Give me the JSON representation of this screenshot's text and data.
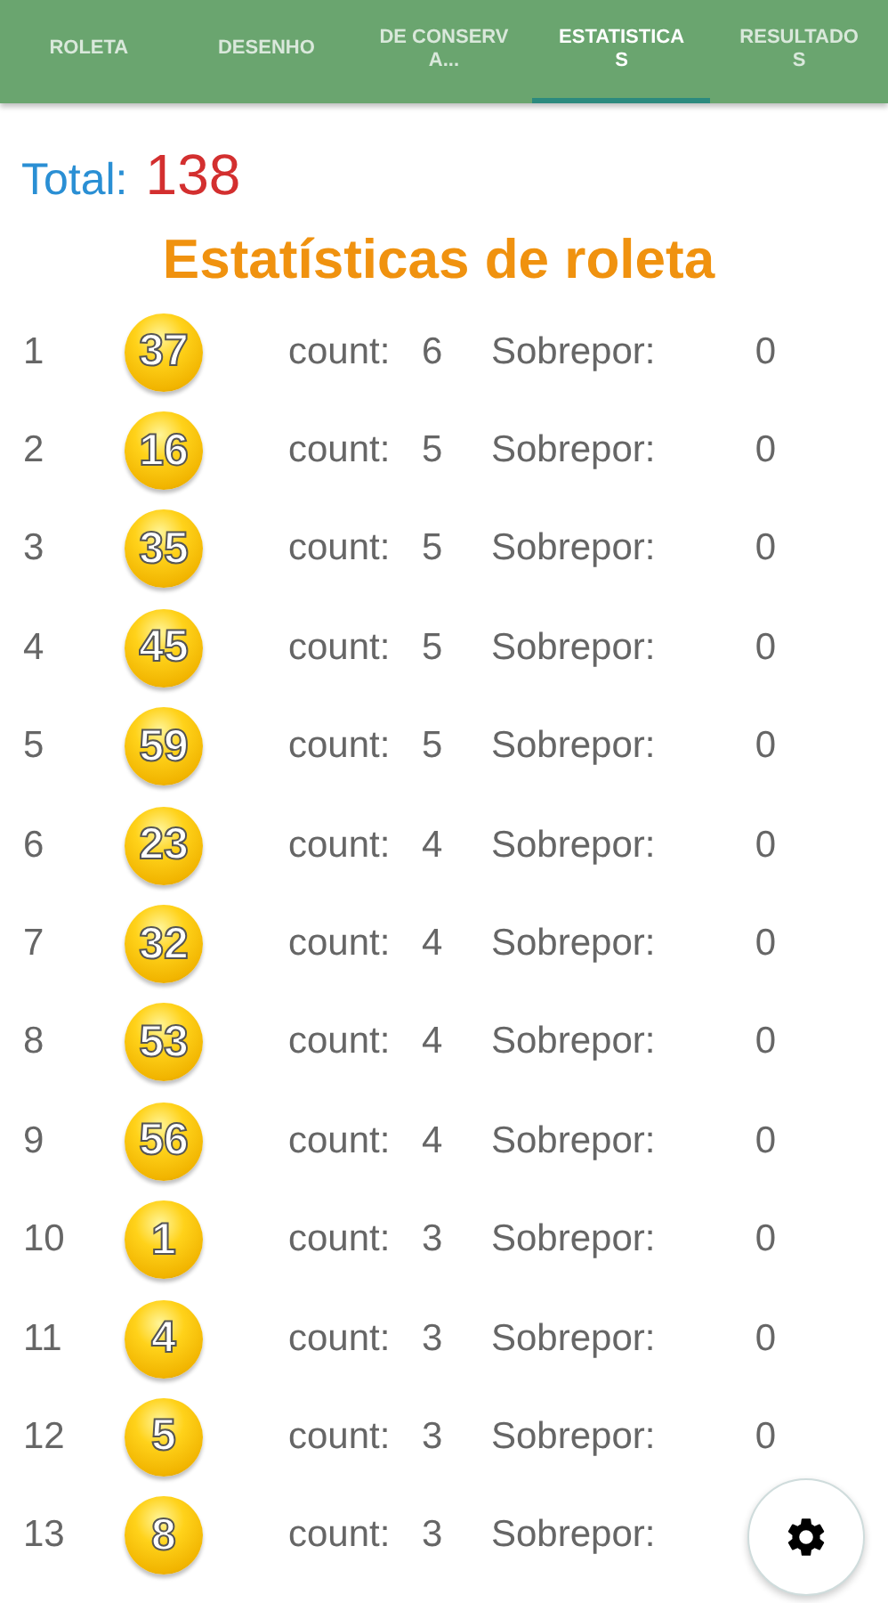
{
  "tabs": [
    {
      "label": "ROLETA",
      "selected": false
    },
    {
      "label": "DESENHO",
      "selected": false
    },
    {
      "label": "DE CONSERVA...",
      "selected": false
    },
    {
      "label": "ESTATISTICAS",
      "selected": true
    },
    {
      "label": "RESULTADOS",
      "selected": false
    }
  ],
  "total": {
    "label": "Total:",
    "value": "138"
  },
  "title": "Estatísticas de roleta",
  "rows": [
    {
      "rank": "1",
      "ball": "37",
      "count_label": "count:",
      "count": "6",
      "overlap_label": "Sobrepor:",
      "overlap": "0"
    },
    {
      "rank": "2",
      "ball": "16",
      "count_label": "count:",
      "count": "5",
      "overlap_label": "Sobrepor:",
      "overlap": "0"
    },
    {
      "rank": "3",
      "ball": "35",
      "count_label": "count:",
      "count": "5",
      "overlap_label": "Sobrepor:",
      "overlap": "0"
    },
    {
      "rank": "4",
      "ball": "45",
      "count_label": "count:",
      "count": "5",
      "overlap_label": "Sobrepor:",
      "overlap": "0"
    },
    {
      "rank": "5",
      "ball": "59",
      "count_label": "count:",
      "count": "5",
      "overlap_label": "Sobrepor:",
      "overlap": "0"
    },
    {
      "rank": "6",
      "ball": "23",
      "count_label": "count:",
      "count": "4",
      "overlap_label": "Sobrepor:",
      "overlap": "0"
    },
    {
      "rank": "7",
      "ball": "32",
      "count_label": "count:",
      "count": "4",
      "overlap_label": "Sobrepor:",
      "overlap": "0"
    },
    {
      "rank": "8",
      "ball": "53",
      "count_label": "count:",
      "count": "4",
      "overlap_label": "Sobrepor:",
      "overlap": "0"
    },
    {
      "rank": "9",
      "ball": "56",
      "count_label": "count:",
      "count": "4",
      "overlap_label": "Sobrepor:",
      "overlap": "0"
    },
    {
      "rank": "10",
      "ball": "1",
      "count_label": "count:",
      "count": "3",
      "overlap_label": "Sobrepor:",
      "overlap": "0"
    },
    {
      "rank": "11",
      "ball": "4",
      "count_label": "count:",
      "count": "3",
      "overlap_label": "Sobrepor:",
      "overlap": "0"
    },
    {
      "rank": "12",
      "ball": "5",
      "count_label": "count:",
      "count": "3",
      "overlap_label": "Sobrepor:",
      "overlap": "0"
    },
    {
      "rank": "13",
      "ball": "8",
      "count_label": "count:",
      "count": "3",
      "overlap_label": "Sobrepor:"
    }
  ]
}
